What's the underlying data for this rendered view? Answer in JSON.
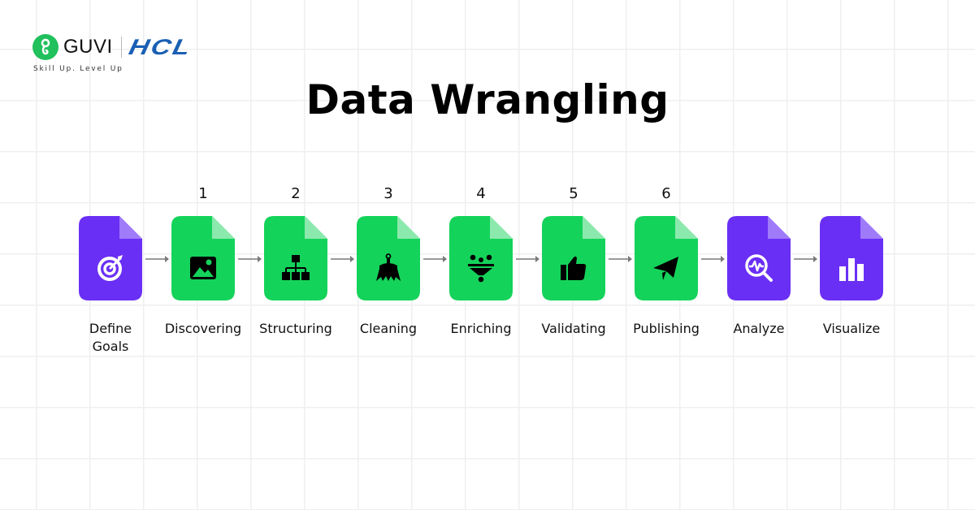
{
  "branding": {
    "brand_name": "GUVI",
    "partner_name": "HCL",
    "tagline": "Skill Up. Level Up",
    "brand_color": "#20c05c",
    "partner_color": "#1a5fb4"
  },
  "title": "Data Wrangling",
  "colors": {
    "purple": "#6a2ff5",
    "purple_fold": "#9f7bfa",
    "green": "#14d35a",
    "green_fold": "#8be9ad"
  },
  "steps": [
    {
      "number": "",
      "label_line1": "Define",
      "label_line2": "Goals",
      "color": "purple",
      "icon": "target-icon"
    },
    {
      "number": "1",
      "label_line1": "Discovering",
      "label_line2": "",
      "color": "green",
      "icon": "image-icon"
    },
    {
      "number": "2",
      "label_line1": "Structuring",
      "label_line2": "",
      "color": "green",
      "icon": "hierarchy-icon"
    },
    {
      "number": "3",
      "label_line1": "Cleaning",
      "label_line2": "",
      "color": "green",
      "icon": "broom-icon"
    },
    {
      "number": "4",
      "label_line1": "Enriching",
      "label_line2": "",
      "color": "green",
      "icon": "funnel-icon"
    },
    {
      "number": "5",
      "label_line1": "Validating",
      "label_line2": "",
      "color": "green",
      "icon": "thumbs-up-icon"
    },
    {
      "number": "6",
      "label_line1": "Publishing",
      "label_line2": "",
      "color": "green",
      "icon": "paper-plane-icon"
    },
    {
      "number": "",
      "label_line1": "Analyze",
      "label_line2": "",
      "color": "purple",
      "icon": "analyze-search-icon"
    },
    {
      "number": "",
      "label_line1": "Visualize",
      "label_line2": "",
      "color": "purple",
      "icon": "bar-chart-icon"
    }
  ]
}
